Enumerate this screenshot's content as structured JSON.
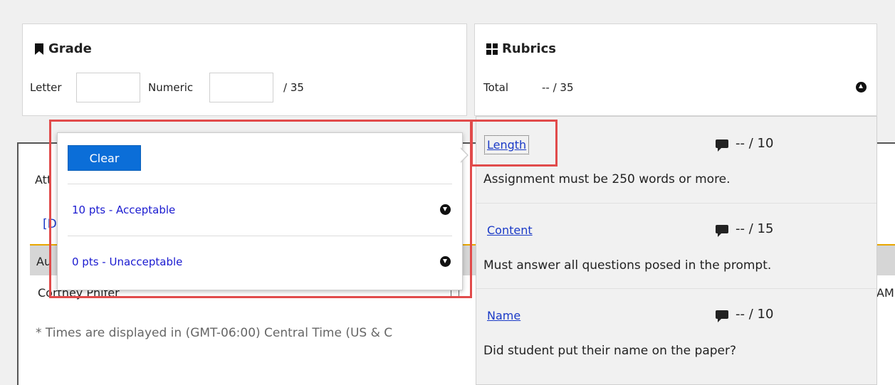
{
  "grade": {
    "title": "Grade",
    "letter_label": "Letter",
    "letter_value": "",
    "numeric_label": "Numeric",
    "numeric_value": "",
    "out_of": "/ 35"
  },
  "rubrics": {
    "title": "Rubrics",
    "total_label": "Total",
    "total_value": "-- / 35"
  },
  "popover": {
    "clear_label": "Clear",
    "levels": [
      {
        "label": "10 pts - Acceptable"
      },
      {
        "label": "0 pts - Unacceptable"
      }
    ]
  },
  "criteria": [
    {
      "name": "Length",
      "score": "-- / 10",
      "description": "Assignment must be 250 words or more."
    },
    {
      "name": "Content",
      "score": "-- / 15",
      "description": "Must answer all questions posed in the prompt."
    },
    {
      "name": "Name",
      "score": "-- / 10",
      "description": "Did student put their name on the paper?"
    }
  ],
  "background": {
    "att_fragment": "Att",
    "d_fragment": "[D",
    "au_fragment": "Au",
    "student_name": "Cortney Phifer",
    "am_fragment": "AM",
    "timezone_note": "* Times are displayed in (GMT-06:00) Central Time (US & C"
  },
  "colors": {
    "accent_blue": "#0b6ed8",
    "annotation_red": "#e14b4b",
    "link_blue": "#1a3ac7"
  }
}
